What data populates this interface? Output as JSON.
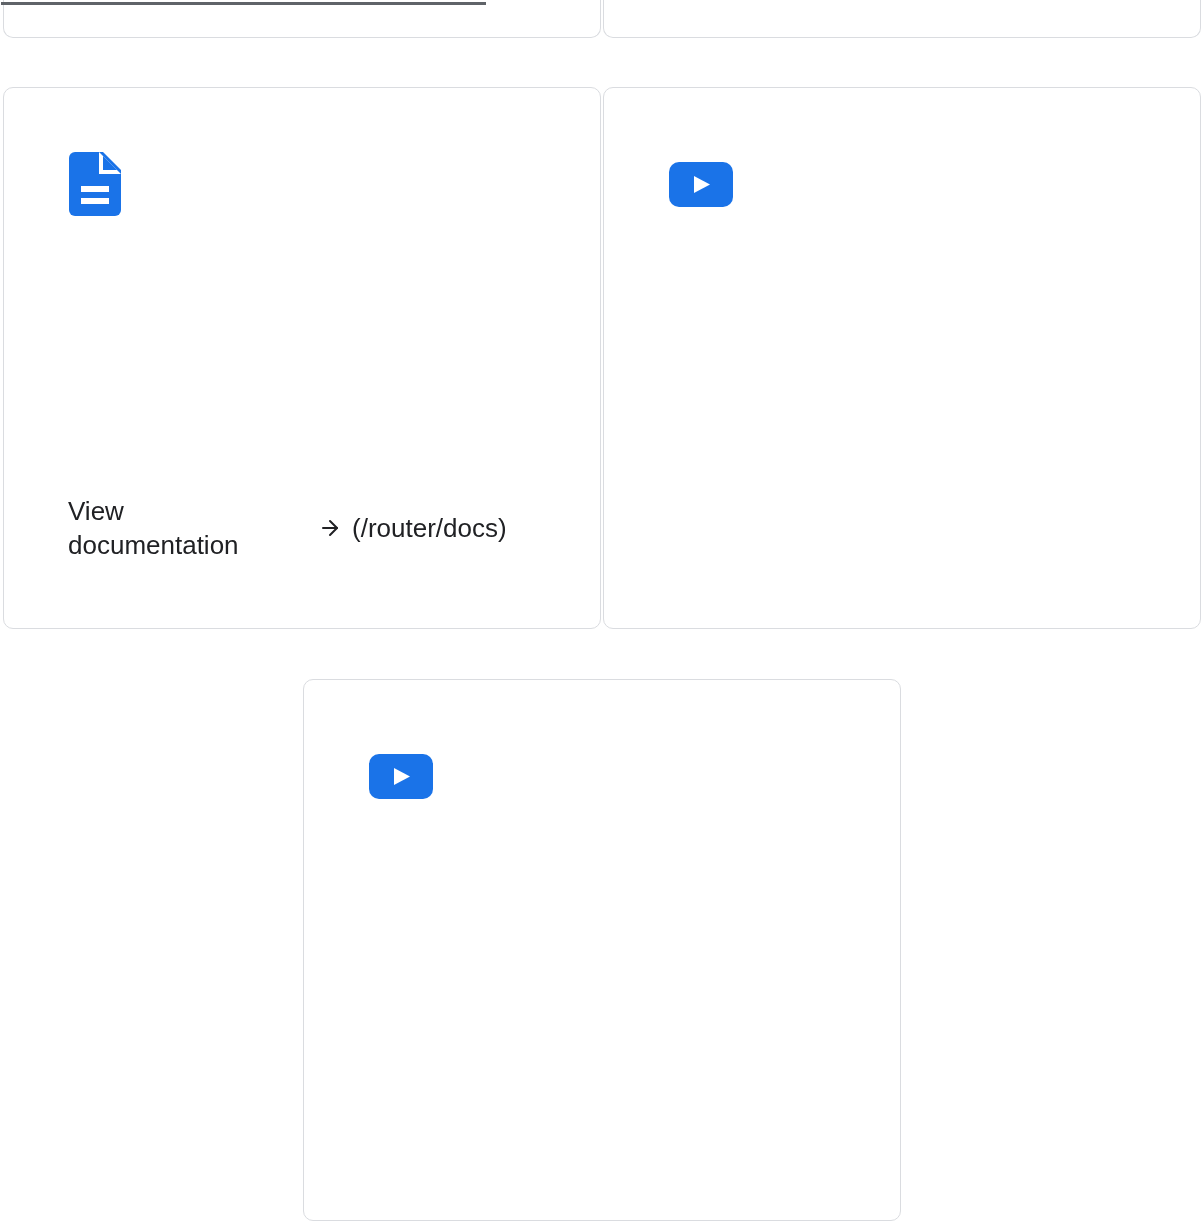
{
  "top_cards": [
    {
      "kind": "progress",
      "level": 0.81
    },
    {
      "kind": "plain"
    }
  ],
  "cards": [
    {
      "kind": "doc",
      "link": {
        "label": "View documentation",
        "target": "(/router/docs)"
      }
    },
    {
      "kind": "video"
    },
    {
      "kind": "video"
    }
  ]
}
